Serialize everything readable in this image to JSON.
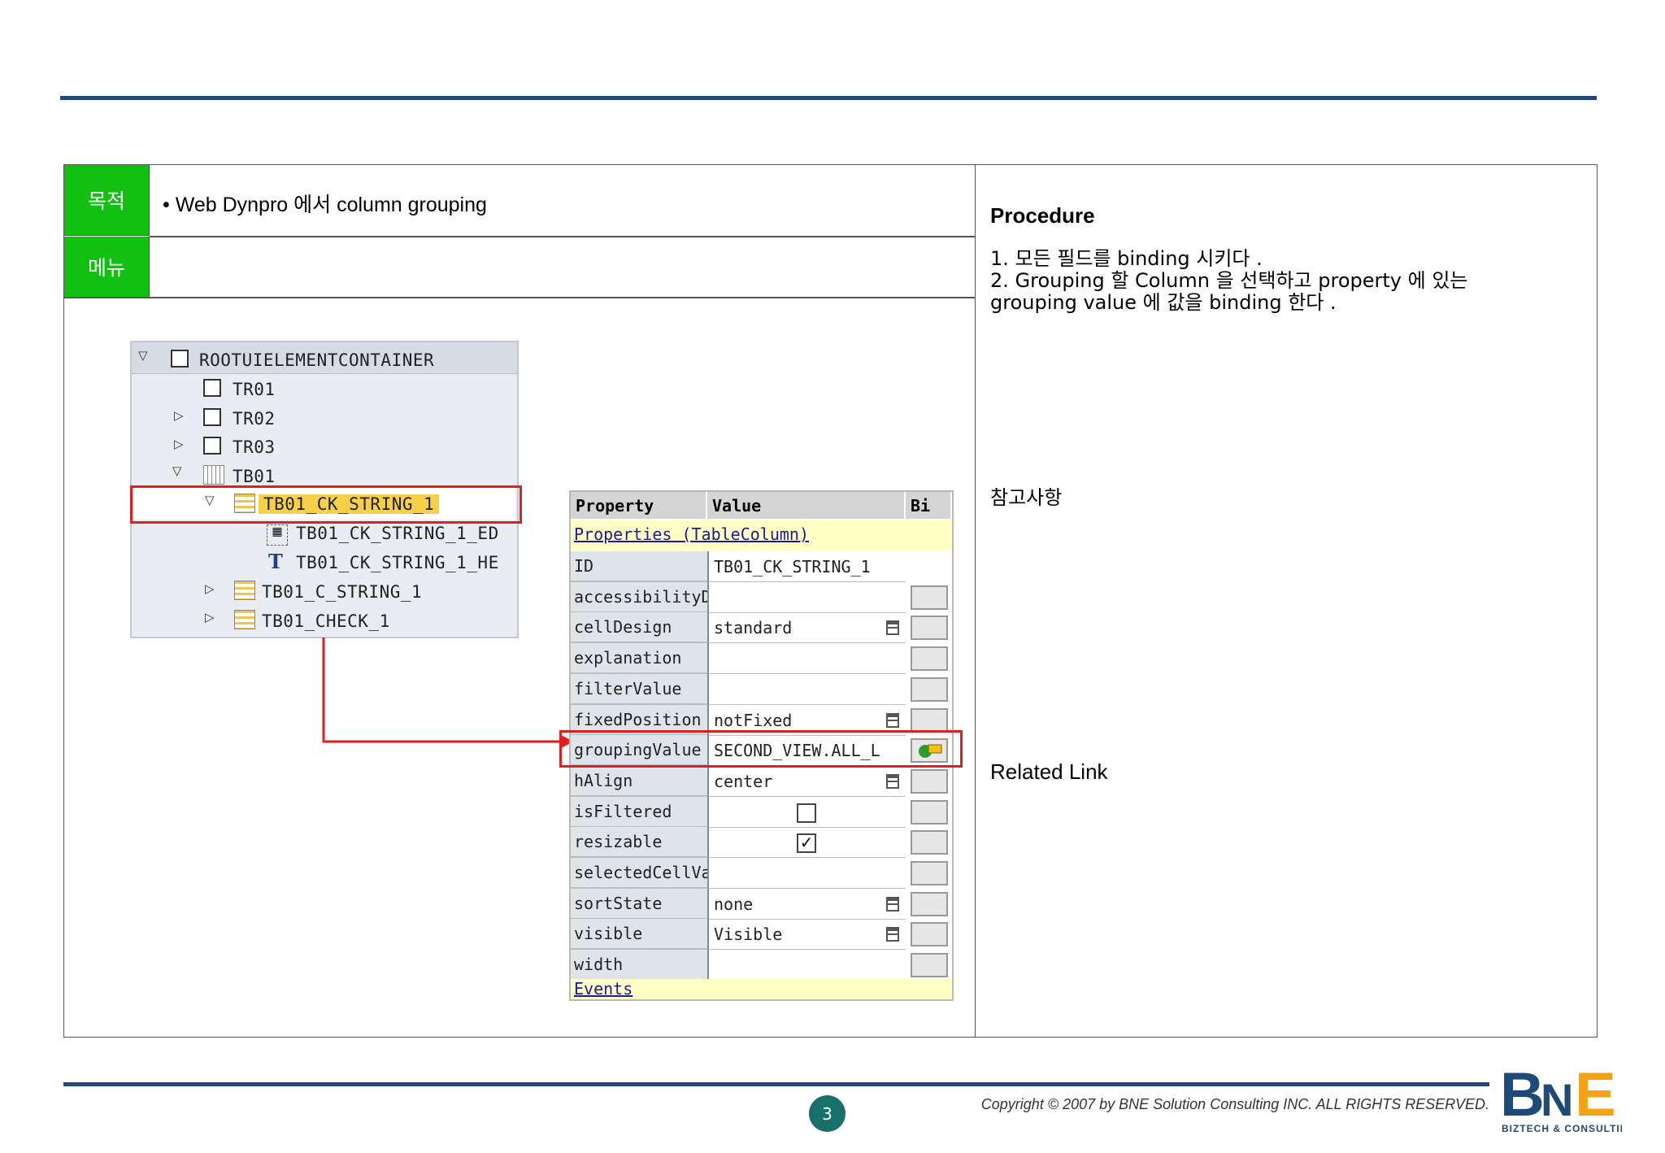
{
  "header": {
    "purpose_label": "목적",
    "menu_label": "메뉴",
    "purpose_text": "• Web Dynpro  에서  column grouping"
  },
  "tree": {
    "root": "ROOTUIELEMENTCONTAINER",
    "items": [
      "TR01",
      "TR02",
      "TR03",
      "TB01"
    ],
    "selected": "TB01_CK_STRING_1",
    "children": [
      "TB01_CK_STRING_1_ED",
      "TB01_CK_STRING_1_HE"
    ],
    "siblings": [
      "TB01_C_STRING_1",
      "TB01_CHECK_1"
    ]
  },
  "properties": {
    "headers": {
      "property": "Property",
      "value": "Value",
      "binding": "Bi"
    },
    "section_title": "Properties (TableColumn)",
    "rows": [
      {
        "name": "ID",
        "value": "TB01_CK_STRING_1"
      },
      {
        "name": "accessibilityDes",
        "value": ""
      },
      {
        "name": "cellDesign",
        "value": "standard"
      },
      {
        "name": "explanation",
        "value": ""
      },
      {
        "name": "filterValue",
        "value": ""
      },
      {
        "name": "fixedPosition",
        "value": "notFixed"
      },
      {
        "name": "groupingValue",
        "value": "SECOND_VIEW.ALL_L"
      },
      {
        "name": "hAlign",
        "value": "center"
      },
      {
        "name": "isFiltered",
        "value": ""
      },
      {
        "name": "resizable",
        "value": ""
      },
      {
        "name": "selectedCellVar",
        "value": ""
      },
      {
        "name": "sortState",
        "value": "none"
      },
      {
        "name": "visible",
        "value": "Visible"
      },
      {
        "name": "width",
        "value": ""
      }
    ],
    "events_label": "Events"
  },
  "right": {
    "procedure_title": "Procedure",
    "steps": [
      "1.  모든  필드를  binding  시키다 .",
      "2.  Grouping  할  Column 을  선택하고  property 에  있는",
      "grouping value 에  값을  binding 한다 ."
    ],
    "notes_title": "참고사항",
    "related_title": "Related Link"
  },
  "footer": {
    "page": "3",
    "copyright": "Copyright © 2007 by BNE Solution Consulting INC.   ALL RIGHTS RESERVED.",
    "logo_text": "BnE",
    "logo_sub": "BIZTECH & CONSULTING"
  },
  "colors": {
    "accent": "#1e4a78",
    "green": "#11c011",
    "highlight_red": "#e01f1f",
    "selected_yellow": "#f7d049"
  }
}
